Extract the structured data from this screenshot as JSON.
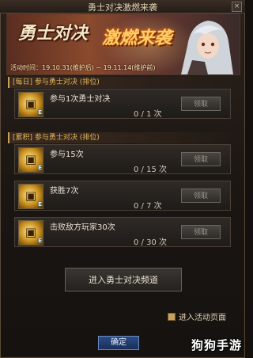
{
  "window": {
    "title": "勇士对决激燃来袭",
    "close_glyph": "×"
  },
  "banner": {
    "logo_part1": "勇士对决",
    "logo_part2": "激燃来袭",
    "date_text": "活动时间：19.10.31(维护后) ~ 19.11.14(维护前)"
  },
  "daily": {
    "header": "[每日] 参与勇士对决 (排位)",
    "tasks": [
      {
        "label": "参与1次勇士对决",
        "progress": "0 / 1 次",
        "claim": "领取",
        "icon": "treasure-chest-icon"
      }
    ]
  },
  "cumulative": {
    "header": "[累积] 参与勇士对决 (排位)",
    "tasks": [
      {
        "label": "参与15次",
        "progress": "0 / 15 次",
        "claim": "领取",
        "icon": "treasure-chest-icon"
      },
      {
        "label": "获胜7次",
        "progress": "0 / 7 次",
        "claim": "领取",
        "icon": "treasure-chest-icon"
      },
      {
        "label": "击败敌方玩家30次",
        "progress": "0 / 30 次",
        "claim": "领取",
        "icon": "treasure-chest-icon"
      }
    ]
  },
  "enter_channel_label": "进入勇士对决频道",
  "activity_page_link": "进入活动页面",
  "confirm_label": "确定",
  "watermark": "狗狗手游",
  "colors": {
    "accent": "#e6b85a",
    "confirm": "#2b4c84"
  }
}
